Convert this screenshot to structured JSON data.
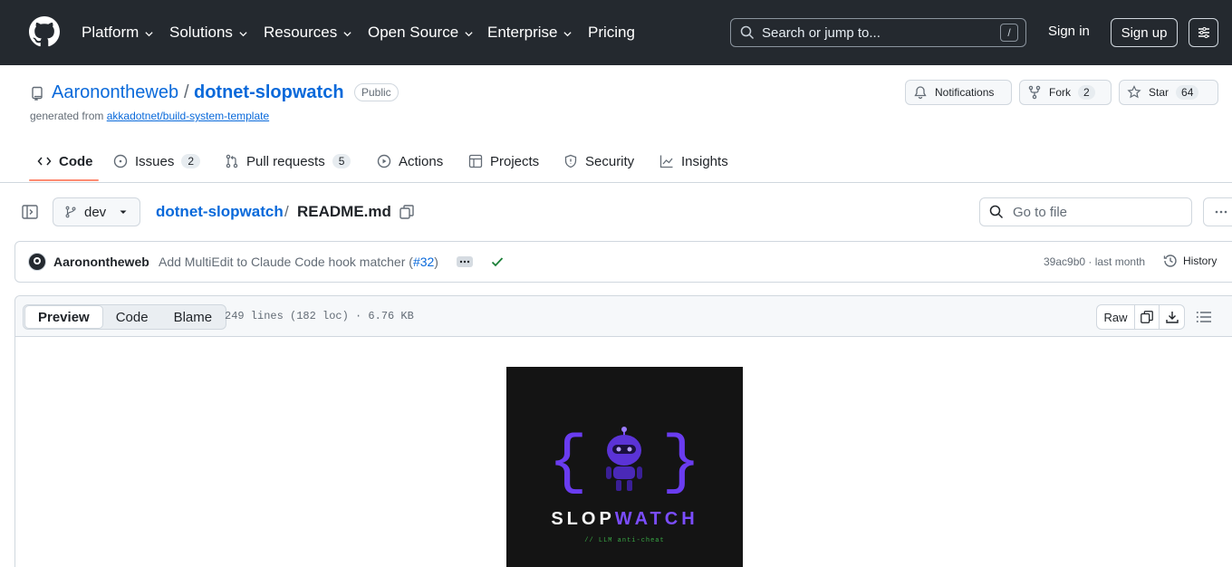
{
  "header": {
    "nav": [
      {
        "label": "Platform",
        "has_dropdown": true
      },
      {
        "label": "Solutions",
        "has_dropdown": true
      },
      {
        "label": "Resources",
        "has_dropdown": true
      },
      {
        "label": "Open Source",
        "has_dropdown": true
      },
      {
        "label": "Enterprise",
        "has_dropdown": true
      },
      {
        "label": "Pricing",
        "has_dropdown": false
      }
    ],
    "search_placeholder": "Search or jump to...",
    "search_shortcut": "/",
    "sign_in": "Sign in",
    "sign_up": "Sign up"
  },
  "repo": {
    "owner": "Aaronontheweb",
    "separator": "/",
    "name": "dotnet-slopwatch",
    "visibility": "Public",
    "generated_from_prefix": "generated from",
    "template": "akkadotnet/build-system-template",
    "notifications_label": "Notifications",
    "fork_label": "Fork",
    "fork_count": "2",
    "star_label": "Star",
    "star_count": "64"
  },
  "tabs": [
    {
      "label": "Code",
      "icon": "code-icon",
      "active": true
    },
    {
      "label": "Issues",
      "icon": "issue-opened-icon",
      "count": "2"
    },
    {
      "label": "Pull requests",
      "icon": "git-pull-request-icon",
      "count": "5"
    },
    {
      "label": "Actions",
      "icon": "play-icon"
    },
    {
      "label": "Projects",
      "icon": "table-icon"
    },
    {
      "label": "Security",
      "icon": "shield-icon"
    },
    {
      "label": "Insights",
      "icon": "graph-icon"
    }
  ],
  "file_nav": {
    "branch": "dev",
    "repo_crumb": "dotnet-slopwatch",
    "crumb_sep": "/",
    "file_name": "README.md",
    "goto_placeholder": "Go to file"
  },
  "commit": {
    "author": "Aaronontheweb",
    "message": "Add MultiEdit to Claude Code hook matcher (",
    "pr": "#32",
    "message_end": ")",
    "sha": "39ac9b0",
    "time_sep": " · ",
    "time": "last month",
    "history_label": "History",
    "status_color": "#1a7f37"
  },
  "file": {
    "views": [
      "Preview",
      "Code",
      "Blame"
    ],
    "active_view": "Preview",
    "meta": "249 lines (182 loc) · 6.76 KB",
    "raw_label": "Raw"
  },
  "readme_logo": {
    "title_part1": "SLOP",
    "title_part2": "WATCH",
    "subtitle": "// LLM anti-cheat",
    "accent_color": "#7b4dff",
    "background": "#141414"
  }
}
